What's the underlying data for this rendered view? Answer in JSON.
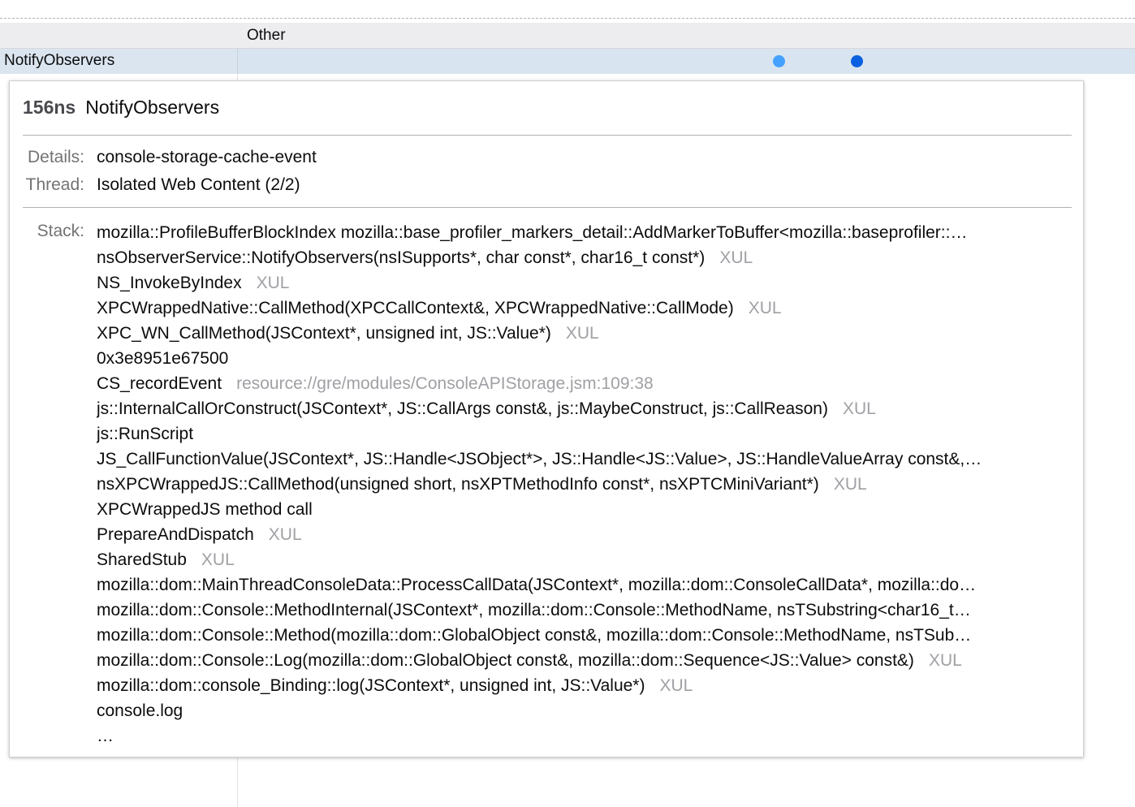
{
  "track": {
    "category_label": "Other",
    "marker_row_label": "NotifyObservers"
  },
  "tooltip": {
    "duration": "156ns",
    "title": "NotifyObservers",
    "details_key": "Details:",
    "details_value": "console-storage-cache-event",
    "thread_key": "Thread:",
    "thread_value": "Isolated Web Content (2/2)",
    "stack_key": "Stack:",
    "stack": [
      {
        "func": "mozilla::ProfileBufferBlockIndex mozilla::base_profiler_markers_detail::AddMarkerToBuffer<mozilla::baseprofiler::…",
        "lib": ""
      },
      {
        "func": "nsObserverService::NotifyObservers(nsISupports*, char const*, char16_t const*)",
        "lib": "XUL"
      },
      {
        "func": "NS_InvokeByIndex",
        "lib": "XUL"
      },
      {
        "func": "XPCWrappedNative::CallMethod(XPCCallContext&, XPCWrappedNative::CallMode)",
        "lib": "XUL"
      },
      {
        "func": "XPC_WN_CallMethod(JSContext*, unsigned int, JS::Value*)",
        "lib": "XUL"
      },
      {
        "func": "0x3e8951e67500",
        "lib": ""
      },
      {
        "func": "CS_recordEvent",
        "lib": "resource://gre/modules/ConsoleAPIStorage.jsm:109:38"
      },
      {
        "func": "js::InternalCallOrConstruct(JSContext*, JS::CallArgs const&, js::MaybeConstruct, js::CallReason)",
        "lib": "XUL"
      },
      {
        "func": "js::RunScript",
        "lib": ""
      },
      {
        "func": "JS_CallFunctionValue(JSContext*, JS::Handle<JSObject*>, JS::Handle<JS::Value>, JS::HandleValueArray const&,…",
        "lib": ""
      },
      {
        "func": "nsXPCWrappedJS::CallMethod(unsigned short, nsXPTMethodInfo const*, nsXPTCMiniVariant*)",
        "lib": "XUL"
      },
      {
        "func": "XPCWrappedJS method call",
        "lib": ""
      },
      {
        "func": "PrepareAndDispatch",
        "lib": "XUL"
      },
      {
        "func": "SharedStub",
        "lib": "XUL"
      },
      {
        "func": "mozilla::dom::MainThreadConsoleData::ProcessCallData(JSContext*, mozilla::dom::ConsoleCallData*, mozilla::do…",
        "lib": ""
      },
      {
        "func": "mozilla::dom::Console::MethodInternal(JSContext*, mozilla::dom::Console::MethodName, nsTSubstring<char16_t…",
        "lib": ""
      },
      {
        "func": "mozilla::dom::Console::Method(mozilla::dom::GlobalObject const&, mozilla::dom::Console::MethodName, nsTSub…",
        "lib": ""
      },
      {
        "func": "mozilla::dom::Console::Log(mozilla::dom::GlobalObject const&, mozilla::dom::Sequence<JS::Value> const&)",
        "lib": "XUL"
      },
      {
        "func": "mozilla::dom::console_Binding::log(JSContext*, unsigned int, JS::Value*)",
        "lib": "XUL"
      },
      {
        "func": "console.log",
        "lib": ""
      },
      {
        "func": "…",
        "lib": ""
      }
    ]
  },
  "colors": {
    "marker_dot_light": "#45a1ff",
    "marker_dot_dark": "#0a60e0",
    "selected_row_bg": "#d8e4ef"
  }
}
